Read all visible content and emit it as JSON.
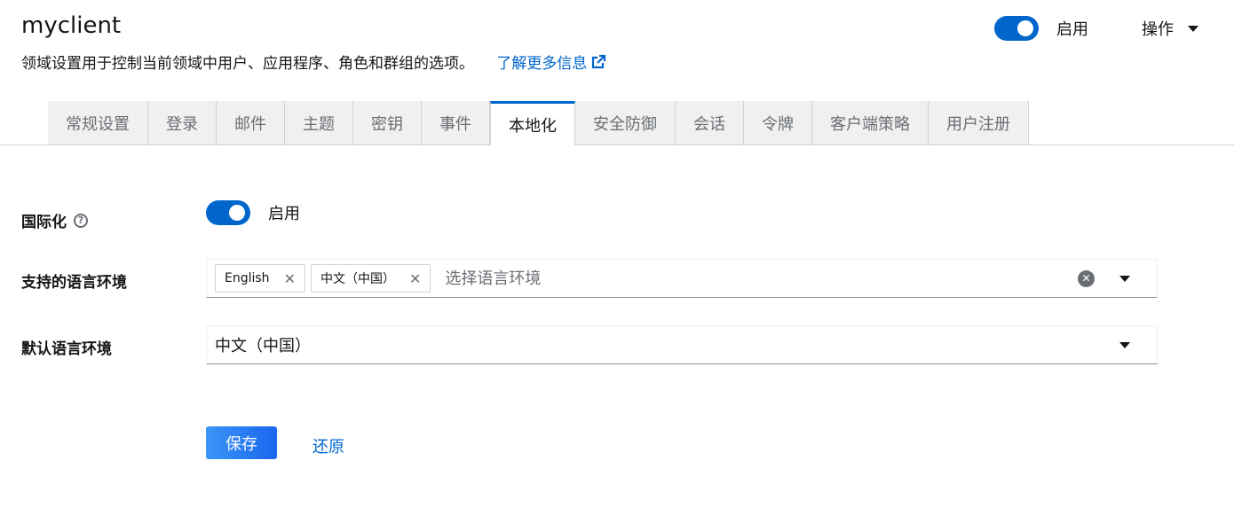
{
  "header": {
    "title": "myclient",
    "description": "领域设置用于控制当前领域中用户、应用程序、角色和群组的选项。",
    "learn_more": "了解更多信息",
    "enabled_label": "启用",
    "actions_label": "操作"
  },
  "tabs": [
    {
      "label": "常规设置",
      "active": false
    },
    {
      "label": "登录",
      "active": false
    },
    {
      "label": "邮件",
      "active": false
    },
    {
      "label": "主题",
      "active": false
    },
    {
      "label": "密钥",
      "active": false
    },
    {
      "label": "事件",
      "active": false
    },
    {
      "label": "本地化",
      "active": true
    },
    {
      "label": "安全防御",
      "active": false
    },
    {
      "label": "会话",
      "active": false
    },
    {
      "label": "令牌",
      "active": false
    },
    {
      "label": "客户端策略",
      "active": false
    },
    {
      "label": "用户注册",
      "active": false
    }
  ],
  "form": {
    "internationalization": {
      "label": "国际化",
      "switch_label": "启用",
      "enabled": true
    },
    "supported_locales": {
      "label": "支持的语言环境",
      "chips": [
        "English",
        "中文（中国）"
      ],
      "placeholder": "选择语言环境"
    },
    "default_locale": {
      "label": "默认语言环境",
      "value": "中文（中国）"
    },
    "save_label": "保存",
    "revert_label": "还原"
  },
  "colors": {
    "accent": "#0066cc",
    "save_gradient_start": "#3b95f5",
    "save_gradient_end": "#1a66f0"
  },
  "icons": {
    "external_link": "external-link-icon",
    "help": "help-icon",
    "chip_close": "close-icon",
    "clear": "clear-icon",
    "dropdown": "caret-down-icon"
  }
}
